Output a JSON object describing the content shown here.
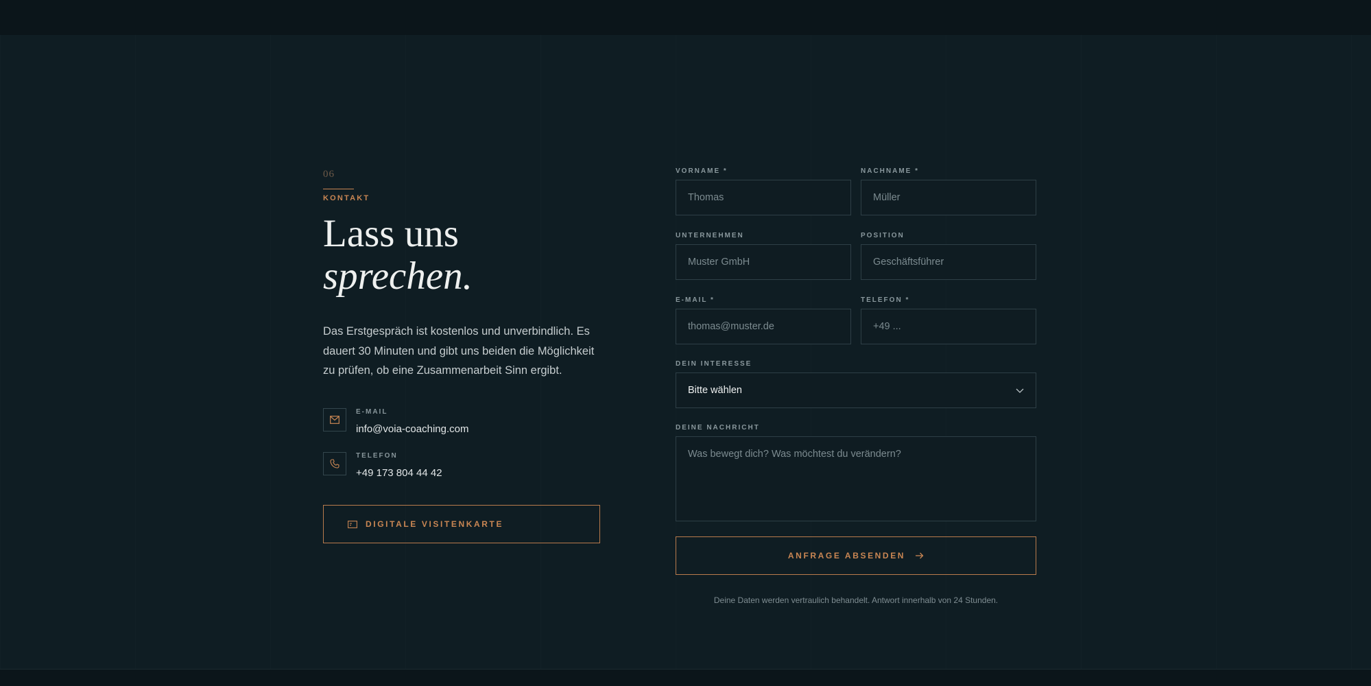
{
  "contact": {
    "section_number": "06",
    "section_label": "KONTAKT",
    "headline_line1": "Lass uns",
    "headline_line2": "sprechen.",
    "intro": "Das Erstgespräch ist kostenlos und unverbindlich. Es dauert 30 Minuten und gibt uns beiden die Möglichkeit zu prüfen, ob eine Zusammenarbeit Sinn ergibt.",
    "email": {
      "label": "E-MAIL",
      "value": "info@voia-coaching.com",
      "icon": "mail-icon"
    },
    "phone": {
      "label": "TELEFON",
      "value": "+49 173 804 44 42",
      "icon": "phone-icon"
    },
    "vcard_button": {
      "label": "DIGITALE VISITENKARTE",
      "icon": "card-icon"
    }
  },
  "form": {
    "firstname": {
      "label": "VORNAME *",
      "placeholder": "Thomas"
    },
    "lastname": {
      "label": "NACHNAME *",
      "placeholder": "Müller"
    },
    "company": {
      "label": "UNTERNEHMEN",
      "placeholder": "Muster GmbH"
    },
    "position": {
      "label": "POSITION",
      "placeholder": "Geschäftsführer"
    },
    "email": {
      "label": "E-MAIL *",
      "placeholder": "thomas@muster.de"
    },
    "phone": {
      "label": "TELEFON *",
      "placeholder": "+49 ..."
    },
    "interest": {
      "label": "DEIN INTERESSE",
      "selected": "Bitte wählen"
    },
    "message": {
      "label": "DEINE NACHRICHT",
      "placeholder": "Was bewegt dich? Was möchtest du verändern?"
    },
    "submit_label": "ANFRAGE ABSENDEN",
    "privacy_note": "Deine Daten werden vertraulich behandelt. Antwort innerhalb von 24 Stunden."
  },
  "colors": {
    "background": "#0f1d23",
    "accent": "#c98653",
    "text": "#eef0ef",
    "border": "#2e3f46"
  }
}
